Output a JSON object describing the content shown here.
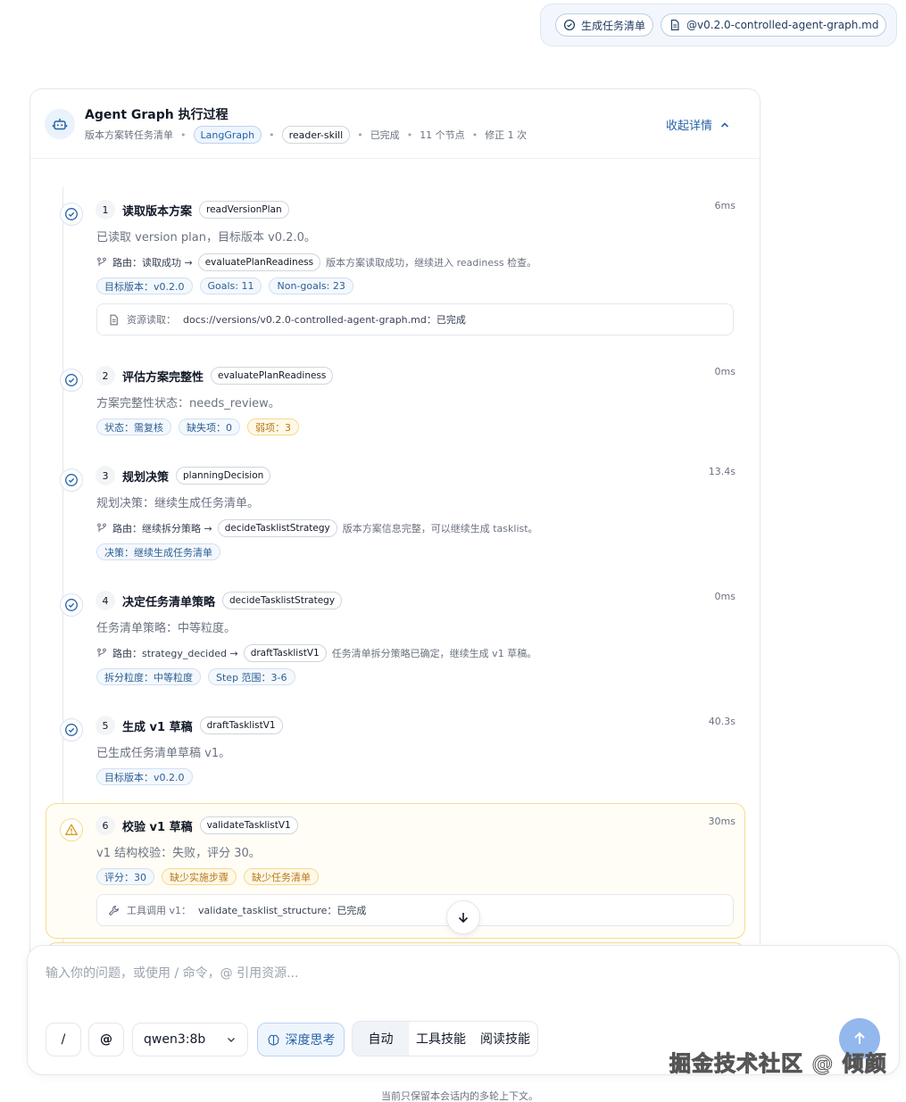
{
  "top_chips": [
    {
      "icon": "check-circle-icon",
      "label": "生成任务清单"
    },
    {
      "icon": "file-icon",
      "label": "@v0.2.0-controlled-agent-graph.md"
    }
  ],
  "header": {
    "title": "Agent Graph 执行过程",
    "subtitle": "版本方案转任务清单",
    "engine_badge": "LangGraph",
    "skill_badge": "reader-skill",
    "status": "已完成",
    "node_count": "11 个节点",
    "revision": "修正 1 次",
    "collapse_label": "收起详情"
  },
  "steps": [
    {
      "num": "1",
      "title": "读取版本方案",
      "code": "readVersionPlan",
      "time": "6ms",
      "summary": "已读取 version plan，目标版本 v0.2.0。",
      "route_label": "路由：读取成功 →",
      "route_target": "evaluatePlanReadiness",
      "route_desc": "版本方案读取成功，继续进入 readiness 检查。",
      "tags": [
        "目标版本：v0.2.0",
        "Goals: 11",
        "Non-goals: 23"
      ],
      "resource_key": "资源读取：",
      "resource_value": "docs://versions/v0.2.0-controlled-agent-graph.md：已完成"
    },
    {
      "num": "2",
      "title": "评估方案完整性",
      "code": "evaluatePlanReadiness",
      "time": "0ms",
      "summary": "方案完整性状态：needs_review。",
      "tags": [
        "状态：需复核",
        "缺失项：0"
      ],
      "warn_tags": [
        "弱项：3"
      ]
    },
    {
      "num": "3",
      "title": "规划决策",
      "code": "planningDecision",
      "time": "13.4s",
      "summary": "规划决策：继续生成任务清单。",
      "route_label": "路由：继续拆分策略 →",
      "route_target": "decideTasklistStrategy",
      "route_desc": "版本方案信息完整，可以继续生成 tasklist。",
      "tags": [
        "决策：继续生成任务清单"
      ]
    },
    {
      "num": "4",
      "title": "决定任务清单策略",
      "code": "decideTasklistStrategy",
      "time": "0ms",
      "summary": "任务清单策略：中等粒度。",
      "route_label": "路由：strategy_decided →",
      "route_target": "draftTasklistV1",
      "route_desc": "任务清单拆分策略已确定，继续生成 v1 草稿。",
      "tags": [
        "拆分粒度：中等粒度",
        "Step 范围：3-6"
      ]
    },
    {
      "num": "5",
      "title": "生成 v1 草稿",
      "code": "draftTasklistV1",
      "time": "40.3s",
      "summary": "已生成任务清单草稿 v1。",
      "tags": [
        "目标版本：v0.2.0"
      ]
    },
    {
      "num": "6",
      "title": "校验 v1 草稿",
      "code": "validateTasklistV1",
      "time": "30ms",
      "summary": "v1 结构校验：失败，评分 30。",
      "tags": [
        "评分：30"
      ],
      "warn_tags": [
        "缺少实施步骤",
        "缺少任务清单"
      ],
      "resource_key": "工具调用 v1：",
      "resource_value": "validate_tasklist_structure：已完成"
    }
  ],
  "composer": {
    "placeholder": "输入你的问题，或使用 / 命令，@ 引用资源...",
    "slash_label": "/",
    "at_label": "@",
    "model": "qwen3:8b",
    "think_label": "深度思考",
    "modes": [
      "自动",
      "工具技能",
      "阅读技能"
    ]
  },
  "footer_note": "当前只保留本会话内的多轮上下文。",
  "watermark": "掘金技术社区 @ 倾颜",
  "colors": {
    "accent": "#2563a8",
    "warning": "#b7791f",
    "send": "#93b8ee"
  }
}
